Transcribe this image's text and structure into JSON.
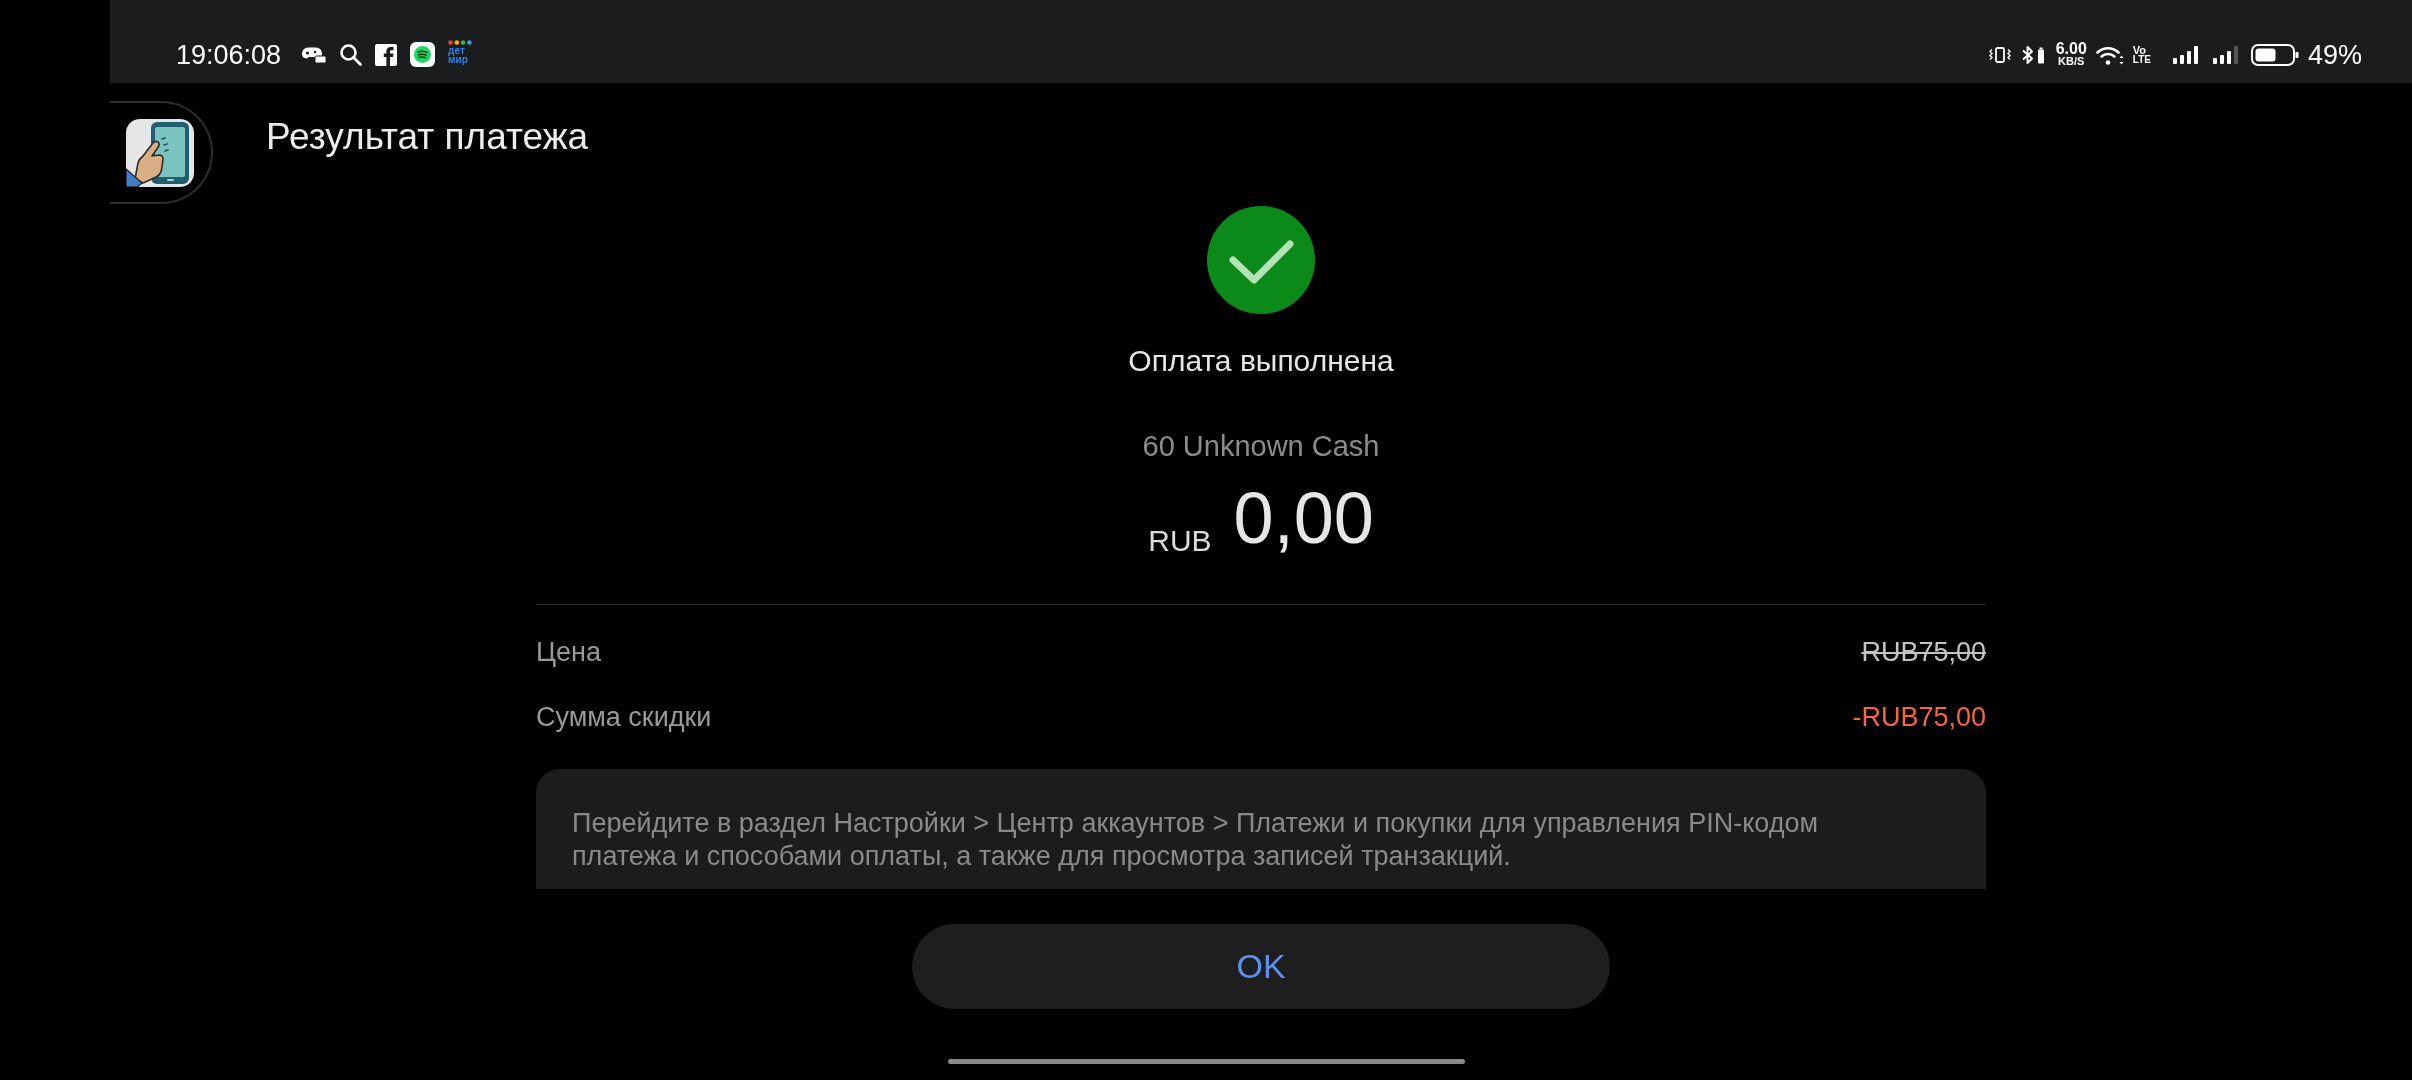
{
  "status_bar": {
    "time": "19:06:08",
    "notification_logo_text": [
      "дет",
      "мир"
    ],
    "net_speed": "6.00",
    "net_speed_unit": "KB/S",
    "volte": [
      "Vo",
      "LTE"
    ],
    "battery": "49%"
  },
  "header": {
    "title": "Результат платежа"
  },
  "result": {
    "kind": "success",
    "message": "Оплата выполнена",
    "product": "60 Unknown Cash",
    "currency": "RUB",
    "amount": "0,00"
  },
  "details": [
    {
      "kind": "original_price",
      "label": "Цена",
      "value": "RUB75,00"
    },
    {
      "kind": "discount",
      "label": "Сумма скидки",
      "value": "-RUB75,00"
    }
  ],
  "info": "Перейдите в раздел Настройки > Центр аккаунтов > Платежи и покупки для управления PIN-кодом платежа и способами оплаты, а также для просмотра записей транзакций.",
  "buttons": [
    "OK"
  ]
}
